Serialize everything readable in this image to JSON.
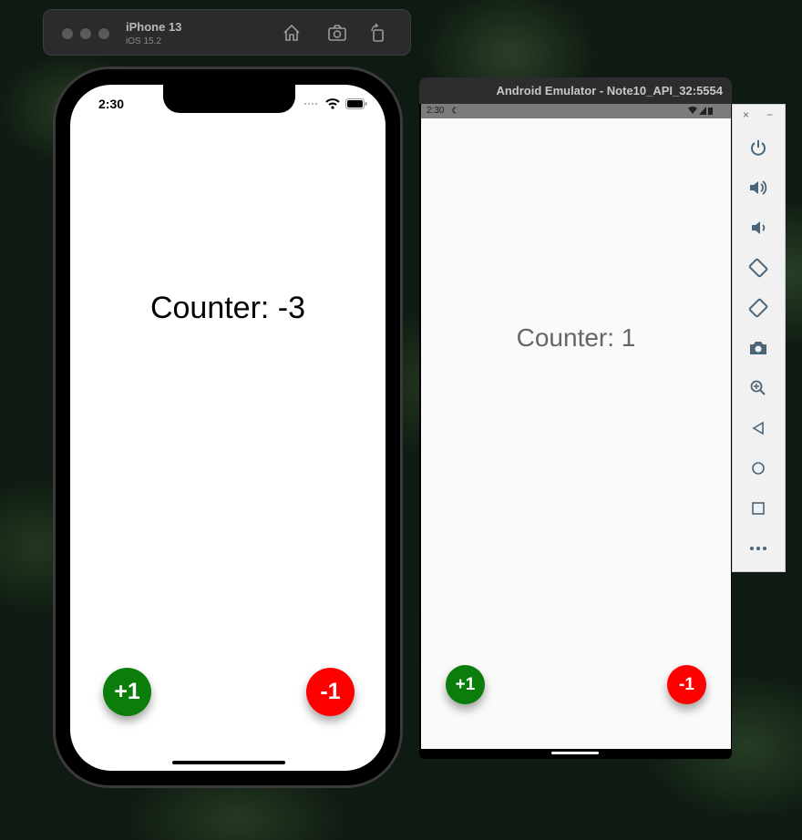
{
  "ios_simulator": {
    "device_name": "iPhone 13",
    "os_version": "iOS 15.2",
    "toolbar_icons": [
      "home-icon",
      "screenshot-icon",
      "rotate-icon"
    ],
    "status_time": "2:30",
    "counter_text": "Counter: -3",
    "increment_label": "+1",
    "decrement_label": "-1"
  },
  "android_emulator": {
    "window_title": "Android Emulator - Note10_API_32:5554",
    "status_time": "2:30",
    "counter_text": "Counter: 1",
    "increment_label": "+1",
    "decrement_label": "-1"
  },
  "emulator_panel": {
    "close_label": "×",
    "minimize_label": "−",
    "buttons": [
      "power-icon",
      "volume-up-icon",
      "volume-down-icon",
      "rotate-left-icon",
      "rotate-right-icon",
      "camera-icon",
      "zoom-icon",
      "back-icon",
      "home-icon",
      "overview-icon",
      "more-icon"
    ]
  },
  "colors": {
    "increment": "#0a7d0a",
    "decrement": "#ff0000",
    "background": "#0f1a12"
  }
}
